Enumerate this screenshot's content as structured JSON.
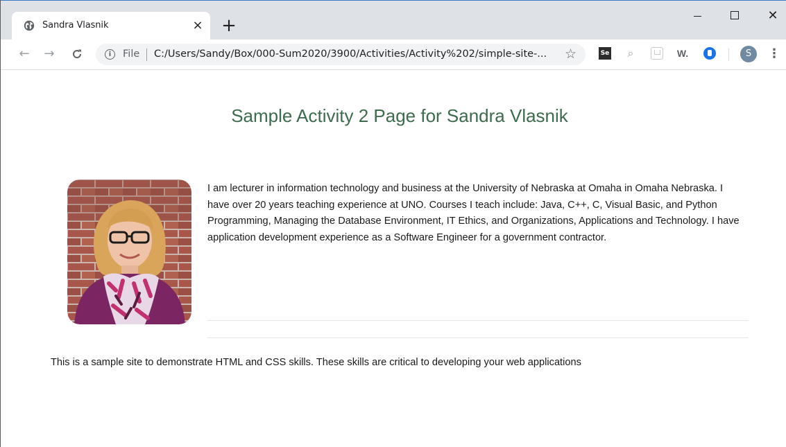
{
  "browser": {
    "tab": {
      "title": "Sandra Vlasnik",
      "close_glyph": "×"
    },
    "new_tab_glyph": "+",
    "window_controls": {
      "close_glyph": "✕"
    },
    "toolbar": {
      "back_glyph": "←",
      "forward_glyph": "→",
      "reload_glyph": "C",
      "info_glyph": "i",
      "scheme_label": "File",
      "url": "C:/Users/Sandy/Box/000-Sum2020/3900/Activities/Activity%202/simple-site-...",
      "star_glyph": "☆",
      "extensions": {
        "se_label": "Se",
        "lens_glyph": "⌕",
        "w_label": "W."
      },
      "avatar_initial": "S",
      "menu_glyph": "⋮"
    },
    "icons": {
      "favicon": "globe-icon",
      "info": "info-icon",
      "star": "star-icon",
      "menu": "vertical-dots-icon"
    }
  },
  "page": {
    "title": "Sample Activity 2 Page for Sandra Vlasnik",
    "bio": "I am lecturer in information technology and business at the University of Nebraska at Omaha in Omaha Nebraska. I have over 20 years teaching experience at UNO. Courses I teach include: Java, C++, C, Visual Basic, and Python Programming, Managing the Database Environment, IT Ethics, and Organizations, Applications and Technology. I have application development experience as a Software Engineer for a government contractor.",
    "footer": "This is a sample site to demonstrate HTML and CSS skills. These skills are critical to developing your web applications",
    "colors": {
      "title": "#3d6b4d",
      "text": "#1a1a1a"
    }
  }
}
